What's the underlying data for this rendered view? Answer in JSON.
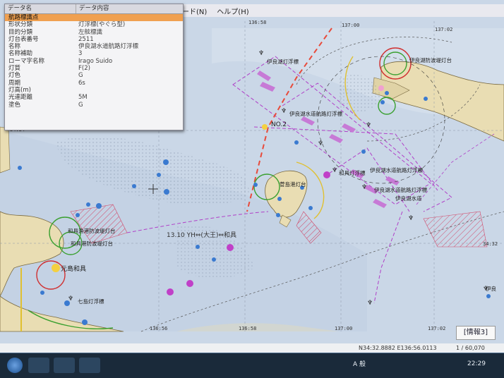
{
  "menu": {
    "items": [
      "ード(N)",
      "ヘルプ(H)"
    ]
  },
  "panel": {
    "header": [
      "データ名",
      "データ内容"
    ],
    "rows": [
      {
        "k": "航路標識点",
        "v": ""
      },
      {
        "k": "形状分類",
        "v": "灯浮標(やぐら型)"
      },
      {
        "k": "目的分類",
        "v": "左舷標識"
      },
      {
        "k": "灯台表番号",
        "v": "2511"
      },
      {
        "k": "名称",
        "v": "伊良湖水道航路灯浮標"
      },
      {
        "k": "名称補助",
        "v": "3"
      },
      {
        "k": "ローマ字名称",
        "v": "Irago Suido"
      },
      {
        "k": "灯質",
        "v": "F(2)"
      },
      {
        "k": "灯色",
        "v": "G"
      },
      {
        "k": "周期",
        "v": "6s"
      },
      {
        "k": "灯高(m)",
        "v": ""
      },
      {
        "k": "光達距離",
        "v": "5M"
      },
      {
        "k": "塗色",
        "v": "G"
      }
    ]
  },
  "grid": {
    "top": [
      "136:58",
      "137:00",
      "137:02"
    ],
    "bottom": [
      "136:56",
      "136:58",
      "137:00",
      "137:02"
    ],
    "left": [
      "34:34"
    ],
    "right": [
      "34:32"
    ]
  },
  "labels": {
    "route": "13.10  YH⇔(大王)⇔和具",
    "no2": "NO.2",
    "irago_channel": "伊良湖水道",
    "kajima": "元島和具",
    "buoy_top": "伊良湖灯浮標",
    "buoy_a": "伊良湖水道航路灯浮標",
    "buoy_b": "伊良湖水道航路灯浮標",
    "buoy_c": "伊良湖水道航路灯浮標",
    "lighthouse_r": "伊良湖防波堤灯台",
    "shima_a": "菅島港灯台",
    "shima_b": "和具灯浮標",
    "left_a": "和具漁港防波堤灯台",
    "left_b": "和具港防波堤灯台",
    "bottom_buoy": "七島灯浮標",
    "right_buoy": "伊良"
  },
  "status": {
    "coords": "N34:32.8882 E136:56.0113",
    "scale": "1 / 60,070"
  },
  "info_button": "[情報3]",
  "taskbar": {
    "ime": "A 般",
    "clock": "22:29"
  },
  "colors": {
    "sea": "#c9d6e6",
    "land": "#e9ddb3",
    "route": "#b040c8",
    "accent": "#f0a050"
  }
}
